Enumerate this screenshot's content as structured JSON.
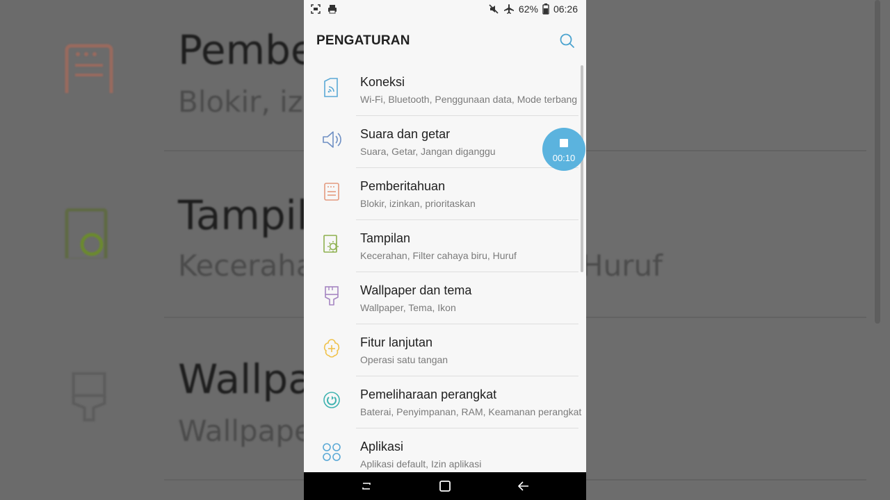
{
  "background": {
    "rows": [
      {
        "title": "Pember",
        "subtitle": "Blokir, izin",
        "subtitle_right": ""
      },
      {
        "title": "Tampila",
        "subtitle": "Kecerahar",
        "subtitle_right": "Huruf"
      },
      {
        "title": "Wallpap",
        "subtitle": "Wallpaper",
        "subtitle_right": ""
      }
    ]
  },
  "status_bar": {
    "battery": "62%",
    "time": "06:26",
    "icons": [
      "screenshot-icon",
      "printer-icon",
      "mute-icon",
      "airplane-icon",
      "battery-icon"
    ]
  },
  "app_bar": {
    "title": "PENGATURAN",
    "search_icon": "search-icon"
  },
  "settings": [
    {
      "title": "Koneksi",
      "subtitle": "Wi-Fi, Bluetooth, Penggunaan data, Mode terbang",
      "icon": "connection-icon",
      "color": "#5aa9d6"
    },
    {
      "title": "Suara dan getar",
      "subtitle": "Suara, Getar, Jangan diganggu",
      "icon": "speaker-icon",
      "color": "#6e8fc4"
    },
    {
      "title": "Pemberitahuan",
      "subtitle": "Blokir, izinkan, prioritaskan",
      "icon": "notification-icon",
      "color": "#e49a7e"
    },
    {
      "title": "Tampilan",
      "subtitle": "Kecerahan, Filter cahaya biru, Huruf",
      "icon": "display-icon",
      "color": "#8db04e"
    },
    {
      "title": "Wallpaper dan tema",
      "subtitle": "Wallpaper, Tema, Ikon",
      "icon": "brush-icon",
      "color": "#a585c2"
    },
    {
      "title": "Fitur lanjutan",
      "subtitle": "Operasi satu tangan",
      "icon": "advanced-features-icon",
      "color": "#f0c24b"
    },
    {
      "title": "Pemeliharaan perangkat",
      "subtitle": "Baterai, Penyimpanan, RAM, Keamanan perangkat",
      "icon": "device-care-icon",
      "color": "#3fb3b0"
    },
    {
      "title": "Aplikasi",
      "subtitle": "Aplikasi default, Izin aplikasi",
      "icon": "apps-icon",
      "color": "#5aa9d6"
    }
  ],
  "recorder": {
    "time": "00:10",
    "icon": "stop-icon",
    "color": "#5bb3de"
  },
  "nav_bar": {
    "icons": [
      "recent-apps-icon",
      "home-icon",
      "back-icon"
    ]
  }
}
